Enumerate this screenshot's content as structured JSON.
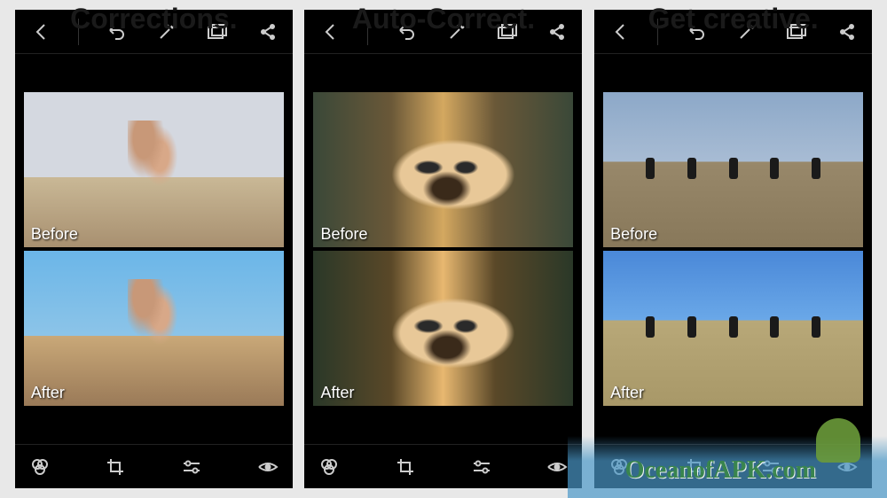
{
  "header_labels": {
    "panel1": "Corrections.",
    "panel2": "Auto-Correct.",
    "panel3": "Get creative."
  },
  "image_labels": {
    "before": "Before",
    "after": "After"
  },
  "watermark": "OceanofAPK.com",
  "toolbar_icons": {
    "back": "back-icon",
    "undo": "undo-icon",
    "magic": "magic-wand-icon",
    "gallery": "gallery-icon",
    "share": "share-icon",
    "filter": "filter-icon",
    "crop": "crop-icon",
    "adjust": "sliders-icon",
    "redeye": "eye-icon"
  },
  "panels": [
    {
      "id": "corrections",
      "before_class": "beach-before",
      "after_class": "beach-after"
    },
    {
      "id": "auto-correct",
      "before_class": "dog-before",
      "after_class": "dog-after"
    },
    {
      "id": "creative",
      "before_class": "kids-before",
      "after_class": "kids-after"
    }
  ]
}
